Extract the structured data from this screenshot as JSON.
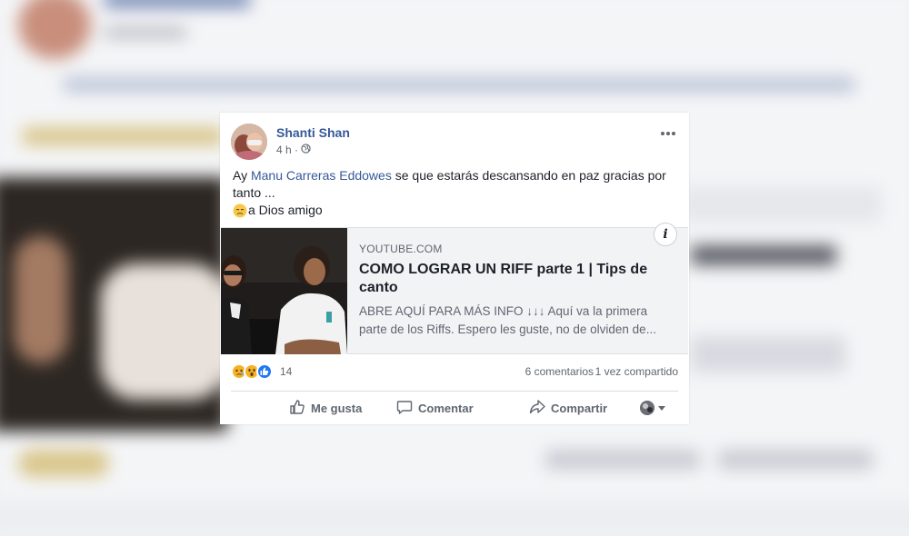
{
  "post": {
    "author": "Shanti Shan",
    "time": "4 h ·",
    "text_prefix": "Ay ",
    "mention": "Manu Carreras Eddowes",
    "text_suffix": " se que estarás descansando en paz gracias por tanto ...",
    "text_line2": "a Dios amigo",
    "privacy_icon": "globe-icon",
    "menu_icon": "more-options-icon"
  },
  "link_preview": {
    "domain": "YOUTUBE.COM",
    "title": "COMO LOGRAR UN RIFF parte 1 | Tips de canto",
    "description": "ABRE AQUÍ PARA MÁS INFO ↓↓↓ Aquí va la primera parte de los Riffs. Espero les guste, no de olviden de...",
    "info_label": "i"
  },
  "stats": {
    "reactions": [
      "sad",
      "wow",
      "like"
    ],
    "reaction_count": "14",
    "comments": "6 comentarios",
    "shares": "1 vez compartido"
  },
  "actions": {
    "like": "Me gusta",
    "comment": "Comentar",
    "share": "Compartir"
  },
  "colors": {
    "link_blue": "#365899",
    "like_blue": "#2078f4",
    "reaction_yellow": "#f7b125"
  }
}
